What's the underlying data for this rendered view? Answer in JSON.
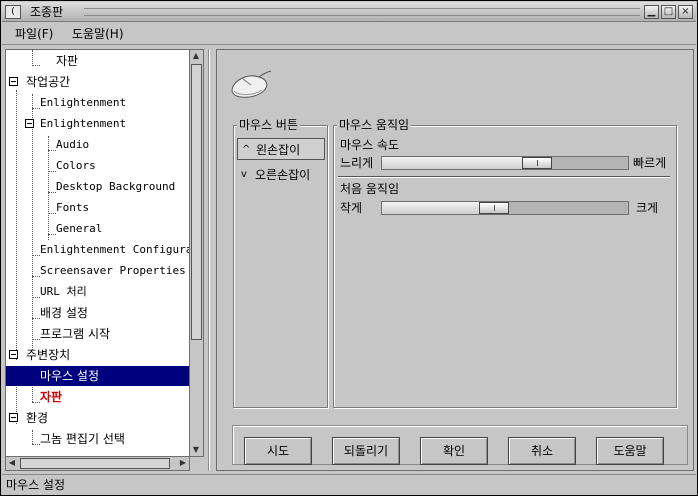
{
  "window": {
    "title": "조종판",
    "menu_glyph": "(",
    "controls": {
      "minimize": "▁",
      "maximize": "□",
      "close": "×"
    }
  },
  "menubar": [
    {
      "label": "파일(F)"
    },
    {
      "label": "도움말(H)"
    }
  ],
  "tree": [
    {
      "label": "자판",
      "level": 2,
      "kor": true,
      "state": ""
    },
    {
      "label": "작업공간",
      "level": 0,
      "kor": true,
      "state": "expanded"
    },
    {
      "label": "Enlightenment",
      "level": 1,
      "kor": false,
      "state": ""
    },
    {
      "label": "Enlightenment",
      "level": 1,
      "kor": false,
      "state": "expanded"
    },
    {
      "label": "Audio",
      "level": 2,
      "kor": false,
      "state": ""
    },
    {
      "label": "Colors",
      "level": 2,
      "kor": false,
      "state": ""
    },
    {
      "label": "Desktop Background",
      "level": 2,
      "kor": false,
      "state": ""
    },
    {
      "label": "Fonts",
      "level": 2,
      "kor": false,
      "state": ""
    },
    {
      "label": "General",
      "level": 2,
      "kor": false,
      "state": ""
    },
    {
      "label": "Enlightenment Configurat",
      "level": 1,
      "kor": false,
      "state": ""
    },
    {
      "label": "Screensaver Properties",
      "level": 1,
      "kor": false,
      "state": ""
    },
    {
      "label": "URL 처리",
      "level": 1,
      "kor": false,
      "state": ""
    },
    {
      "label": "배경 설정",
      "level": 1,
      "kor": true,
      "state": ""
    },
    {
      "label": "프로그램 시작",
      "level": 1,
      "kor": true,
      "state": ""
    },
    {
      "label": "주변장치",
      "level": 0,
      "kor": true,
      "state": "expanded"
    },
    {
      "label": "마우스 설정",
      "level": 1,
      "kor": true,
      "state": "selected"
    },
    {
      "label": "자판",
      "level": 1,
      "kor": true,
      "state": "red"
    },
    {
      "label": "환경",
      "level": 0,
      "kor": true,
      "state": "expanded"
    },
    {
      "label": "그놈 편집기 선택",
      "level": 1,
      "kor": true,
      "state": ""
    }
  ],
  "mouse_buttons": {
    "title": "마우스 버튼",
    "options": [
      {
        "label": "왼손잡이",
        "glyph": "^",
        "selected": true
      },
      {
        "label": "오른손잡이",
        "glyph": "v",
        "selected": false
      }
    ]
  },
  "mouse_motion": {
    "title": "마우스 움직임",
    "speed": {
      "label": "마우스 속도",
      "min_label": "느리게",
      "max_label": "빠르게",
      "value": 0.65
    },
    "threshold": {
      "label": "처음 움직임",
      "min_label": "작게",
      "max_label": "크게",
      "value": 0.45
    }
  },
  "buttons": [
    {
      "label": "시도"
    },
    {
      "label": "되돌리기"
    },
    {
      "label": "확인"
    },
    {
      "label": "취소"
    },
    {
      "label": "도움말"
    }
  ],
  "statusbar": {
    "text": "마우스 설정"
  },
  "colors": {
    "selection": "#00007f",
    "warning_text": "#d00000",
    "window_bg": "#c6c6c6"
  },
  "icons": {
    "mouse": "mouse-icon",
    "expander": "tree-collapse-icon"
  }
}
